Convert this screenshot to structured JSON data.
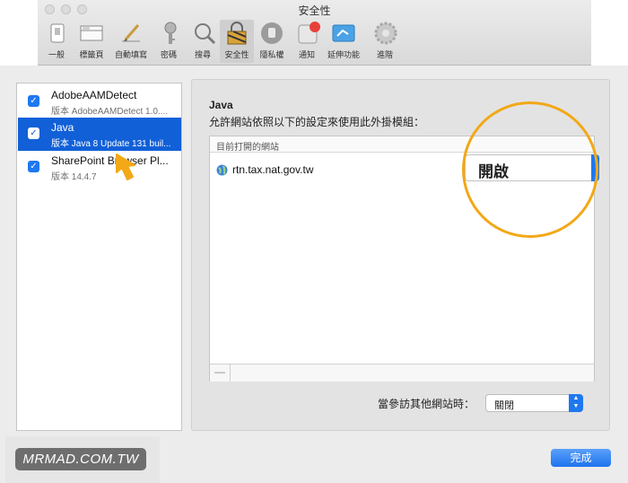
{
  "window": {
    "title": "安全性"
  },
  "toolbar": {
    "items": [
      {
        "label": "一般",
        "icon": "switch-icon"
      },
      {
        "label": "標籤頁",
        "icon": "tabs-icon"
      },
      {
        "label": "自動填寫",
        "icon": "pencil-icon"
      },
      {
        "label": "密碼",
        "icon": "key-icon"
      },
      {
        "label": "搜尋",
        "icon": "magnifier-icon"
      },
      {
        "label": "安全性",
        "icon": "lock-icon"
      },
      {
        "label": "隱私權",
        "icon": "hand-icon"
      },
      {
        "label": "通知",
        "icon": "notification-icon"
      },
      {
        "label": "延伸功能",
        "icon": "puzzle-icon"
      },
      {
        "label": "進階",
        "icon": "gear-icon"
      }
    ],
    "selected": "安全性"
  },
  "plugins": [
    {
      "name": "AdobeAAMDetect",
      "version": "版本 AdobeAAMDetect 1.0....",
      "checked": true
    },
    {
      "name": "Java",
      "version": "版本 Java 8 Update 131 buil...",
      "checked": true,
      "selected": true
    },
    {
      "name": "SharePoint Browser Pl...",
      "version": "版本 14.4.7",
      "checked": true
    }
  ],
  "settings": {
    "title": "Java",
    "description": "允許網站依照以下的設定來使用此外掛模組：",
    "column_header": "目前打開的網站",
    "sites": [
      {
        "domain": "rtn.tax.nat.gov.tw",
        "setting": "開啟"
      }
    ],
    "remove_label": "—",
    "other_sites_label": "當參訪其他網站時：",
    "other_sites_value": "關閉"
  },
  "done_label": "完成",
  "watermark": "MRMAD.COM.TW",
  "colors": {
    "accent": "#1e78ef",
    "highlight_circle": "#f2a817",
    "selection": "#1160d8"
  }
}
